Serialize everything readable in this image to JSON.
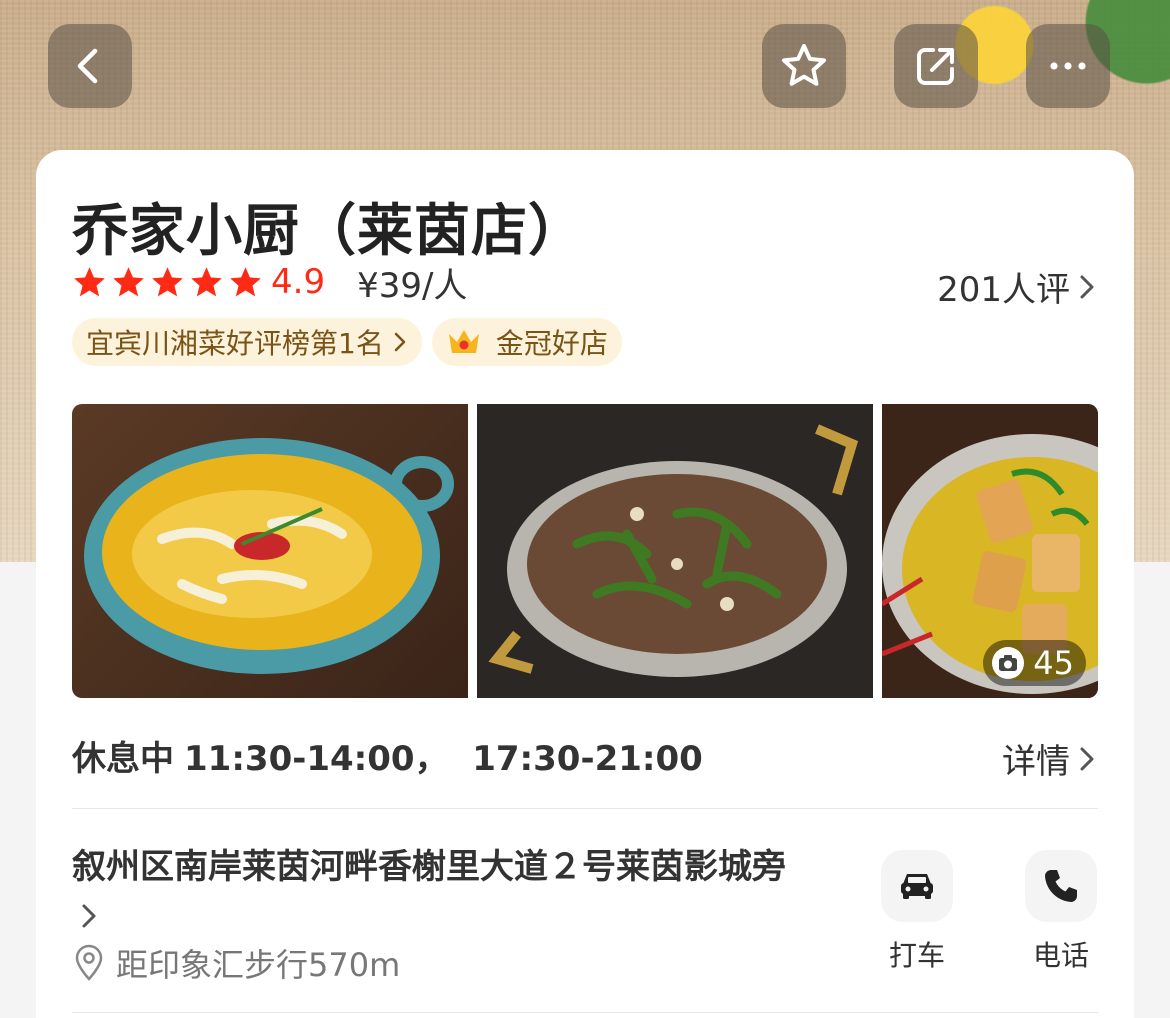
{
  "header": {
    "back_icon": "chevron-left-icon",
    "favorite_icon": "star-outline-icon",
    "share_icon": "share-icon",
    "more_icon": "more-dots-icon"
  },
  "shop": {
    "name": "乔家小厨（莱茵店）",
    "stars": 5,
    "score": "4.9",
    "price": "¥39/人",
    "reviews": "201人评"
  },
  "badges": [
    {
      "label": "宜宾川湘菜好评榜第1名"
    },
    {
      "label": "金冠好店"
    }
  ],
  "photos": {
    "items": [
      "fish-soup-dish",
      "pepper-meat-stirfry-dish",
      "tofu-soup-dish"
    ],
    "count": "45"
  },
  "hours": {
    "status": "休息中",
    "times": "11:30-14:00，  17:30-21:00",
    "details_label": "详情"
  },
  "address": {
    "text": "叙州区南岸莱茵河畔香榭里大道２号莱茵影城旁",
    "distance": "距印象汇步行570m"
  },
  "actions": {
    "taxi_label": "打车",
    "phone_label": "电话"
  },
  "colors": {
    "star": "#ff2a14",
    "badge_bg": "#fdf3dc",
    "badge_text": "#7a5316"
  }
}
